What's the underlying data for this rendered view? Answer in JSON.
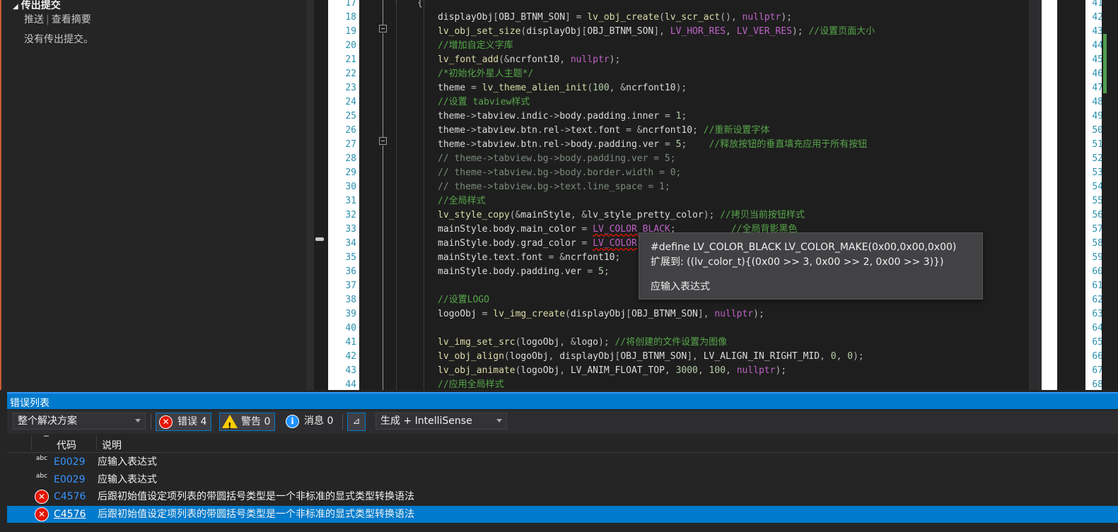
{
  "left_panel": {
    "section_title": "传出提交",
    "link_push": "推送",
    "link_separator": "|",
    "link_summary": "查看摘要",
    "empty_message": "没有传出提交。"
  },
  "editor": {
    "line_numbers": [
      "17",
      "18",
      "19",
      "20",
      "21",
      "22",
      "23",
      "24",
      "25",
      "26",
      "27",
      "28",
      "29",
      "30",
      "31",
      "32",
      "33",
      "34",
      "35",
      "36",
      "37",
      "38",
      "39",
      "40",
      "41",
      "42",
      "43",
      "44"
    ],
    "lines": [
      [
        {
          "t": "{",
          "c": "op"
        }
      ],
      [
        {
          "t": "displayObj",
          "c": "var"
        },
        {
          "t": "[",
          "c": "op"
        },
        {
          "t": "OBJ_BTNM_SON",
          "c": "var"
        },
        {
          "t": "] = ",
          "c": "op"
        },
        {
          "t": "lv_obj_create",
          "c": "fn"
        },
        {
          "t": "(",
          "c": "op"
        },
        {
          "t": "lv_scr_act",
          "c": "fn"
        },
        {
          "t": "(), ",
          "c": "op"
        },
        {
          "t": "nullptr",
          "c": "const"
        },
        {
          "t": ");",
          "c": "op"
        }
      ],
      [
        {
          "t": "lv_obj_set_size",
          "c": "fn"
        },
        {
          "t": "(",
          "c": "op"
        },
        {
          "t": "displayObj",
          "c": "var"
        },
        {
          "t": "[",
          "c": "op"
        },
        {
          "t": "OBJ_BTNM_SON",
          "c": "var"
        },
        {
          "t": "], ",
          "c": "op"
        },
        {
          "t": "LV_HOR_RES",
          "c": "const"
        },
        {
          "t": ", ",
          "c": "op"
        },
        {
          "t": "LV_VER_RES",
          "c": "const"
        },
        {
          "t": "); ",
          "c": "op"
        },
        {
          "t": "//设置页面大小",
          "c": "cm"
        }
      ],
      [
        {
          "t": "//增加自定义字库",
          "c": "cm"
        }
      ],
      [
        {
          "t": "lv_font_add",
          "c": "fn"
        },
        {
          "t": "(&",
          "c": "op"
        },
        {
          "t": "ncrfont10",
          "c": "var"
        },
        {
          "t": ", ",
          "c": "op"
        },
        {
          "t": "nullptr",
          "c": "const"
        },
        {
          "t": ");",
          "c": "op"
        }
      ],
      [
        {
          "t": "/*初始化外星人主题*/",
          "c": "cm"
        }
      ],
      [
        {
          "t": "theme",
          "c": "var"
        },
        {
          "t": " = ",
          "c": "op"
        },
        {
          "t": "lv_theme_alien_init",
          "c": "fn"
        },
        {
          "t": "(",
          "c": "op"
        },
        {
          "t": "100",
          "c": "num"
        },
        {
          "t": ", &",
          "c": "op"
        },
        {
          "t": "ncrfont10",
          "c": "var"
        },
        {
          "t": ");",
          "c": "op"
        }
      ],
      [
        {
          "t": "//设置 tabview样式",
          "c": "cm"
        }
      ],
      [
        {
          "t": "theme",
          "c": "var"
        },
        {
          "t": "->",
          "c": "op"
        },
        {
          "t": "tabview",
          "c": "var"
        },
        {
          "t": ".",
          "c": "op"
        },
        {
          "t": "indic",
          "c": "var"
        },
        {
          "t": "->",
          "c": "op"
        },
        {
          "t": "body",
          "c": "var"
        },
        {
          "t": ".",
          "c": "op"
        },
        {
          "t": "padding",
          "c": "var"
        },
        {
          "t": ".",
          "c": "op"
        },
        {
          "t": "inner",
          "c": "var"
        },
        {
          "t": " = ",
          "c": "op"
        },
        {
          "t": "1",
          "c": "num"
        },
        {
          "t": ";",
          "c": "op"
        }
      ],
      [
        {
          "t": "theme",
          "c": "var"
        },
        {
          "t": "->",
          "c": "op"
        },
        {
          "t": "tabview",
          "c": "var"
        },
        {
          "t": ".",
          "c": "op"
        },
        {
          "t": "btn",
          "c": "var"
        },
        {
          "t": ".",
          "c": "op"
        },
        {
          "t": "rel",
          "c": "var"
        },
        {
          "t": "->",
          "c": "op"
        },
        {
          "t": "text",
          "c": "var"
        },
        {
          "t": ".",
          "c": "op"
        },
        {
          "t": "font",
          "c": "var"
        },
        {
          "t": " = &",
          "c": "op"
        },
        {
          "t": "ncrfont10",
          "c": "var"
        },
        {
          "t": "; ",
          "c": "op"
        },
        {
          "t": "//重新设置字体",
          "c": "cm"
        }
      ],
      [
        {
          "t": "theme",
          "c": "var"
        },
        {
          "t": "->",
          "c": "op"
        },
        {
          "t": "tabview",
          "c": "var"
        },
        {
          "t": ".",
          "c": "op"
        },
        {
          "t": "btn",
          "c": "var"
        },
        {
          "t": ".",
          "c": "op"
        },
        {
          "t": "rel",
          "c": "var"
        },
        {
          "t": "->",
          "c": "op"
        },
        {
          "t": "body",
          "c": "var"
        },
        {
          "t": ".",
          "c": "op"
        },
        {
          "t": "padding",
          "c": "var"
        },
        {
          "t": ".",
          "c": "op"
        },
        {
          "t": "ver",
          "c": "var"
        },
        {
          "t": " = ",
          "c": "op"
        },
        {
          "t": "5",
          "c": "num"
        },
        {
          "t": ";    ",
          "c": "op"
        },
        {
          "t": "//释放按钮的垂直填充应用于所有按钮",
          "c": "cm"
        }
      ],
      [
        {
          "t": "// theme->tabview.bg->body.padding.ver = 5;",
          "c": "cmg"
        }
      ],
      [
        {
          "t": "// theme->tabview.bg->body.border.width = 0;",
          "c": "cmg"
        }
      ],
      [
        {
          "t": "// theme->tabview.bg->text.line_space = 1;",
          "c": "cmg"
        }
      ],
      [
        {
          "t": "//全局样式",
          "c": "cm"
        }
      ],
      [
        {
          "t": "lv_style_copy",
          "c": "fn"
        },
        {
          "t": "(&",
          "c": "op"
        },
        {
          "t": "mainStyle",
          "c": "var"
        },
        {
          "t": ", &",
          "c": "op"
        },
        {
          "t": "lv_style_pretty_color",
          "c": "var"
        },
        {
          "t": "); ",
          "c": "op"
        },
        {
          "t": "//拷贝当前按钮样式",
          "c": "cm"
        }
      ],
      [
        {
          "t": "mainStyle",
          "c": "var"
        },
        {
          "t": ".",
          "c": "op"
        },
        {
          "t": "body",
          "c": "var"
        },
        {
          "t": ".",
          "c": "op"
        },
        {
          "t": "main_color",
          "c": "var"
        },
        {
          "t": " = ",
          "c": "op"
        },
        {
          "t": "LV_COLOR_BLACK",
          "c": "const",
          "sq": true
        },
        {
          "t": ";          ",
          "c": "op"
        },
        {
          "t": "//全局背影黑色",
          "c": "cm"
        }
      ],
      [
        {
          "t": "mainStyle",
          "c": "var"
        },
        {
          "t": ".",
          "c": "op"
        },
        {
          "t": "body",
          "c": "var"
        },
        {
          "t": ".",
          "c": "op"
        },
        {
          "t": "grad_color",
          "c": "var"
        },
        {
          "t": " = ",
          "c": "op"
        },
        {
          "t": "LV_COLOR",
          "c": "const",
          "sq": true
        }
      ],
      [
        {
          "t": "mainStyle",
          "c": "var"
        },
        {
          "t": ".",
          "c": "op"
        },
        {
          "t": "text",
          "c": "var"
        },
        {
          "t": ".",
          "c": "op"
        },
        {
          "t": "font",
          "c": "var"
        },
        {
          "t": " = &",
          "c": "op"
        },
        {
          "t": "ncrfont10",
          "c": "var"
        },
        {
          "t": ";",
          "c": "op"
        }
      ],
      [
        {
          "t": "mainStyle",
          "c": "var"
        },
        {
          "t": ".",
          "c": "op"
        },
        {
          "t": "body",
          "c": "var"
        },
        {
          "t": ".",
          "c": "op"
        },
        {
          "t": "padding",
          "c": "var"
        },
        {
          "t": ".",
          "c": "op"
        },
        {
          "t": "ver",
          "c": "var"
        },
        {
          "t": " = ",
          "c": "op"
        },
        {
          "t": "5",
          "c": "num"
        },
        {
          "t": ";",
          "c": "op"
        }
      ],
      [],
      [
        {
          "t": "//设置LOGO",
          "c": "cm"
        }
      ],
      [
        {
          "t": "logoObj",
          "c": "var"
        },
        {
          "t": " = ",
          "c": "op"
        },
        {
          "t": "lv_img_create",
          "c": "fn"
        },
        {
          "t": "(",
          "c": "op"
        },
        {
          "t": "displayObj",
          "c": "var"
        },
        {
          "t": "[",
          "c": "op"
        },
        {
          "t": "OBJ_BTNM_SON",
          "c": "var"
        },
        {
          "t": "], ",
          "c": "op"
        },
        {
          "t": "nullptr",
          "c": "const"
        },
        {
          "t": ");",
          "c": "op"
        }
      ],
      [],
      [
        {
          "t": "lv_img_set_src",
          "c": "fn"
        },
        {
          "t": "(",
          "c": "op"
        },
        {
          "t": "logoObj",
          "c": "var"
        },
        {
          "t": ", &",
          "c": "op"
        },
        {
          "t": "logo",
          "c": "var"
        },
        {
          "t": "); ",
          "c": "op"
        },
        {
          "t": "//将创建的文件设置为图像",
          "c": "cm"
        }
      ],
      [
        {
          "t": "lv_obj_align",
          "c": "fn"
        },
        {
          "t": "(",
          "c": "op"
        },
        {
          "t": "logoObj",
          "c": "var"
        },
        {
          "t": ", ",
          "c": "op"
        },
        {
          "t": "displayObj",
          "c": "var"
        },
        {
          "t": "[",
          "c": "op"
        },
        {
          "t": "OBJ_BTNM_SON",
          "c": "var"
        },
        {
          "t": "], ",
          "c": "op"
        },
        {
          "t": "LV_ALIGN_IN_RIGHT_MID",
          "c": "var"
        },
        {
          "t": ", ",
          "c": "op"
        },
        {
          "t": "0",
          "c": "num"
        },
        {
          "t": ", ",
          "c": "op"
        },
        {
          "t": "0",
          "c": "num"
        },
        {
          "t": ");",
          "c": "op"
        }
      ],
      [
        {
          "t": "lv_obj_animate",
          "c": "fn"
        },
        {
          "t": "(",
          "c": "op"
        },
        {
          "t": "logoObj",
          "c": "var"
        },
        {
          "t": ", ",
          "c": "op"
        },
        {
          "t": "LV_ANIM_FLOAT_TOP",
          "c": "var"
        },
        {
          "t": ", ",
          "c": "op"
        },
        {
          "t": "3000",
          "c": "num"
        },
        {
          "t": ", ",
          "c": "op"
        },
        {
          "t": "100",
          "c": "num"
        },
        {
          "t": ", ",
          "c": "op"
        },
        {
          "t": "nullptr",
          "c": "const"
        },
        {
          "t": ");",
          "c": "op"
        }
      ],
      [
        {
          "t": "//应用全局样式",
          "c": "cm"
        }
      ]
    ]
  },
  "tooltip": {
    "define_line": "#define LV_COLOR_BLACK LV_COLOR_MAKE(0x00,0x00,0x00)",
    "expand_line": "扩展到: ((lv_color_t){(0x00 >> 3, 0x00 >> 2, 0x00 >> 3)})",
    "error_text": "应输入表达式"
  },
  "right_editor": {
    "line_numbers": [
      "41",
      "42",
      "43",
      "44",
      "45",
      "46",
      "47",
      "48",
      "49",
      "50",
      "51",
      "52",
      "53",
      "54",
      "55",
      "56",
      "57",
      "58",
      "59",
      "60",
      "61",
      "62",
      "63",
      "64",
      "65",
      "66",
      "67",
      "68"
    ]
  },
  "error_list": {
    "title": "错误列表",
    "scope_dropdown": "整个解决方案",
    "errors_button": "错误 4",
    "warnings_button": "警告 0",
    "messages_button": "消息 0",
    "build_dropdown": "生成 + IntelliSense",
    "col_code": "代码",
    "col_desc": "说明",
    "rows": [
      {
        "icon": "intellisense",
        "code": "E0029",
        "desc": "应输入表达式"
      },
      {
        "icon": "intellisense",
        "code": "E0029",
        "desc": "应输入表达式"
      },
      {
        "icon": "error",
        "code": "C4576",
        "desc": "后跟初始值设定项列表的带圆括号类型是一个非标准的显式类型转换语法"
      },
      {
        "icon": "error",
        "code": "C4576",
        "desc": "后跟初始值设定项列表的带圆括号类型是一个非标准的显式类型转换语法"
      }
    ]
  },
  "colors": {
    "accent": "#007acc",
    "error_red": "#e51400",
    "line_number": "#2b91af",
    "comment": "#57a64a"
  }
}
